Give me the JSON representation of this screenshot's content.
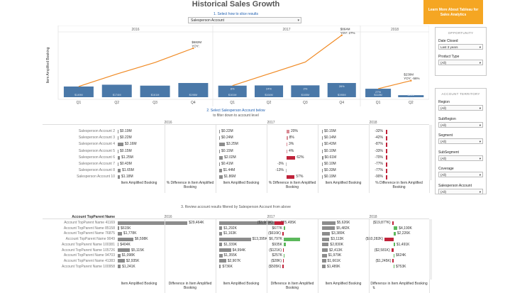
{
  "title": "Historical Sales Growth",
  "slice": {
    "label": "1. Select how to slice results",
    "value": "Salesperson Account"
  },
  "cta": {
    "line1": "Learn More About Tableau for",
    "line2": "Sales Analytics"
  },
  "chart_data": {
    "type": "bar",
    "ylabel": "Item Amplified Booking",
    "years": [
      "2016",
      "2017",
      "2018"
    ],
    "quarters": [
      [
        "Q1",
        "Q2",
        "Q3",
        "Q4"
      ],
      [
        "Q1",
        "Q2",
        "Q3",
        "Q4"
      ],
      [
        "Q1",
        "Q2"
      ]
    ],
    "bar_labels": [
      [
        "$149M",
        "$174M",
        "$161M",
        "$198M"
      ],
      [
        "$161M",
        "$164M",
        "$165M",
        "$198M"
      ],
      [
        "$118M",
        "$28M"
      ]
    ],
    "pct_labels": [
      [
        "",
        "",
        "",
        ""
      ],
      [
        "8%",
        "24%",
        "2%",
        "26%"
      ],
      [
        "27%",
        "-80%"
      ]
    ],
    "callouts": [
      {
        "value": "$682M",
        "sub": "YOY:"
      },
      {
        "value": "$864M",
        "sub": "YOY: 27%"
      },
      {
        "value": "$230M",
        "sub": "YOY: -56%"
      }
    ],
    "values": [
      149,
      174,
      161,
      198,
      161,
      164,
      165,
      198,
      118,
      28
    ],
    "cumulative": [
      149,
      323,
      484,
      682,
      161,
      325,
      490,
      864,
      118,
      230
    ],
    "ylim": [
      0,
      900
    ]
  },
  "section2": {
    "title": "2. Select Salesperson Account below",
    "subtitle": "to filter down to account level"
  },
  "t1": {
    "years": [
      "2016",
      "2017",
      "2018"
    ],
    "cols": [
      "Item Amplified Booking",
      "% Difference in Item Amplified Booking",
      "Item Amplified Booking",
      "% Difference in Item Amplified Booking",
      "Item Amplified Booking",
      "% Difference in Item Amplified Booking"
    ],
    "rows": [
      {
        "name": "Salesperson Account 2",
        "a": "$0.19M",
        "b": "$0.22M",
        "bp": "20%",
        "c": "$0.15M",
        "cp": "-32%"
      },
      {
        "name": "Salesperson Account 3",
        "a": "$0.22M",
        "b": "$0.24M",
        "bp": "8%",
        "c": "$0.14M",
        "cp": "-42%"
      },
      {
        "name": "Salesperson Account 4",
        "a": "$3.16M",
        "b": "$3.25M",
        "bp": "3%",
        "c": "$0.43M",
        "cp": "-87%"
      },
      {
        "name": "Salesperson Account 5",
        "a": "$0.15M",
        "b": "$0.15M",
        "bp": "4%",
        "c": "$0.10M",
        "cp": "-33%"
      },
      {
        "name": "Salesperson Account 6",
        "a": "$1.25M",
        "b": "$2.02M",
        "bp": "62%",
        "c": "$0.61M",
        "cp": "-70%"
      },
      {
        "name": "Salesperson Account 7",
        "a": "$0.43M",
        "b": "$0.41M",
        "bp": "-3%",
        "c": "$0.10M",
        "cp": "-77%"
      },
      {
        "name": "Salesperson Account 8",
        "a": "$1.65M",
        "b": "$1.44M",
        "bp": "-13%",
        "c": "$0.33M",
        "cp": "-77%"
      },
      {
        "name": "Salesperson Account 10",
        "a": "$1.18M",
        "b": "$1.86M",
        "bp": "57%",
        "c": "$0.19M",
        "cp": "-90%"
      }
    ]
  },
  "section3": {
    "title": "3. Review account results filtered by Salesperson Account from above",
    "col_header": "Account TopParent Name"
  },
  "t2": {
    "years": [
      "2016",
      "2017",
      "2018"
    ],
    "cols": [
      "Item Amplified Booking",
      "Difference in Item Amplified Booking",
      "Item Amplified Booking",
      "Difference in Item Amplified Booking",
      "Item Amplified Booking",
      "Difference in Item Amplified Booking"
    ],
    "rows": [
      {
        "name": "Account TopParent Name 41169",
        "a": "$29,464K",
        "b": "$25,495K",
        "bd": "($3,969K)",
        "c": "$5,626K",
        "cd": "($19,87?K)"
      },
      {
        "name": "Account TopParent Name 85158",
        "a": "$615K",
        "b": "$1,292K",
        "bd": "$677K",
        "c": "$5,482K",
        "cd": "$4,190K"
      },
      {
        "name": "Account TopParent Name 76875",
        "a": "$1,778K",
        "b": "$1,163K",
        "bd": "($616K)",
        "c": "$3,389K",
        "cd": "$2,226K"
      },
      {
        "name": "Account TopParent Name 9049",
        "a": "$6,598K",
        "b": "$13,395K",
        "bd": "$6,797K",
        "c": "$3,113K",
        "cd": "($10,282K)"
      },
      {
        "name": "Account TopParent Name 100381",
        "a": "$404K",
        "b": "$1,339K",
        "bd": "$935K",
        "c": "$2,830K",
        "cd": "$1,491K"
      },
      {
        "name": "Account TopParent Name 105726",
        "a": "$5,115K",
        "b": "$4,994K",
        "bd": "($121K)",
        "c": "$2,413K",
        "cd": "($2,581K)"
      },
      {
        "name": "Account TopParent Name 94703",
        "a": "$1,098K",
        "b": "$1,355K",
        "bd": "$257K",
        "c": "$1,979K",
        "cd": "$624K"
      },
      {
        "name": "Account TopParent Name 41383",
        "a": "$2,935K",
        "b": "$2,907K",
        "bd": "($28K)",
        "c": "$1,661K",
        "cd": "($1,245K)"
      },
      {
        "name": "Account TopParent Name 100958",
        "a": "$1,241K",
        "b": "$736K",
        "bd": "($505K)",
        "c": "$1,489K",
        "cd": "$753K"
      }
    ]
  },
  "filters1": {
    "header": "OPPORTUNITY",
    "items": [
      {
        "label": "Date Closed",
        "value": "Last 3 years"
      },
      {
        "label": "Product Type",
        "value": "(All)"
      }
    ]
  },
  "filters2": {
    "header": "ACCOUNT TERRITORY",
    "items": [
      {
        "label": "Region",
        "value": "(All)"
      },
      {
        "label": "SubRegion",
        "value": "(All)"
      },
      {
        "label": "Segment",
        "value": "(All)"
      },
      {
        "label": "SubSegment",
        "value": "(All)"
      },
      {
        "label": "Coverage",
        "value": "(All)"
      },
      {
        "label": "Salesperson Account",
        "value": "(All)"
      }
    ]
  },
  "colors": {
    "bar": "#4a78a8",
    "line": "#f08a24",
    "neg": "#c0233a",
    "pos": "#5cb85c",
    "gray": "#8c8c8c",
    "accent": "#1f5fb0",
    "cta": "#f5a623"
  }
}
